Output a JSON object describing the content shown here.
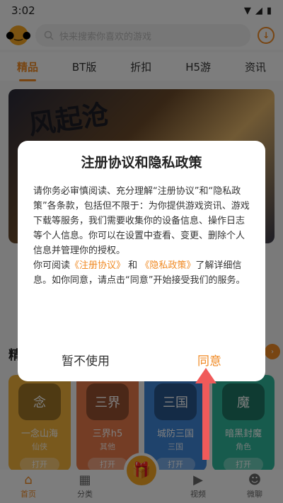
{
  "status": {
    "time": "3:02"
  },
  "search": {
    "placeholder": "快来搜索你喜欢的游戏"
  },
  "tabs": [
    {
      "label": "精品"
    },
    {
      "label": "BT版"
    },
    {
      "label": "折扣"
    },
    {
      "label": "H5游"
    },
    {
      "label": "资讯"
    }
  ],
  "banner": {
    "title": "风起沧"
  },
  "section": {
    "title": "精"
  },
  "games": [
    {
      "name": "一念山海",
      "genre": "仙侠",
      "button": "打开",
      "color": "#f3b23b",
      "art": "念"
    },
    {
      "name": "三界h5",
      "genre": "其他",
      "button": "打开",
      "color": "#e97b4a",
      "art": "三界"
    },
    {
      "name": "城防三国",
      "genre": "三国",
      "button": "打开",
      "color": "#3f86d8",
      "art": "三国"
    },
    {
      "name": "暗黑封魔",
      "genre": "角色",
      "button": "打开",
      "color": "#2fb79a",
      "art": "魔"
    }
  ],
  "bottom_nav": {
    "home": "首页",
    "category": "分类",
    "video": "视频",
    "chat": "微聊"
  },
  "dialog": {
    "title": "注册协议和隐私政策",
    "para1": "请你务必审慎阅读、充分理解“注册协议”和“隐私政策”各条款，包括但不限于：为你提供游戏资讯、游戏下载等服务，我们需要收集你的设备信息、操作日志等个人信息。你可以在设置中查看、变更、删除个人信息并管理你的授权。",
    "p2_prefix": "你可阅读",
    "link_register": "《注册协议》",
    "p2_and": "和",
    "link_privacy": "《隐私政策》",
    "p2_suffix": "了解详细信息。如你同意，请点击“同意”开始接受我们的服务。",
    "decline": "暂不使用",
    "agree": "同意"
  },
  "colors": {
    "accent": "#f08a24",
    "arrow": "#f05a5a"
  }
}
